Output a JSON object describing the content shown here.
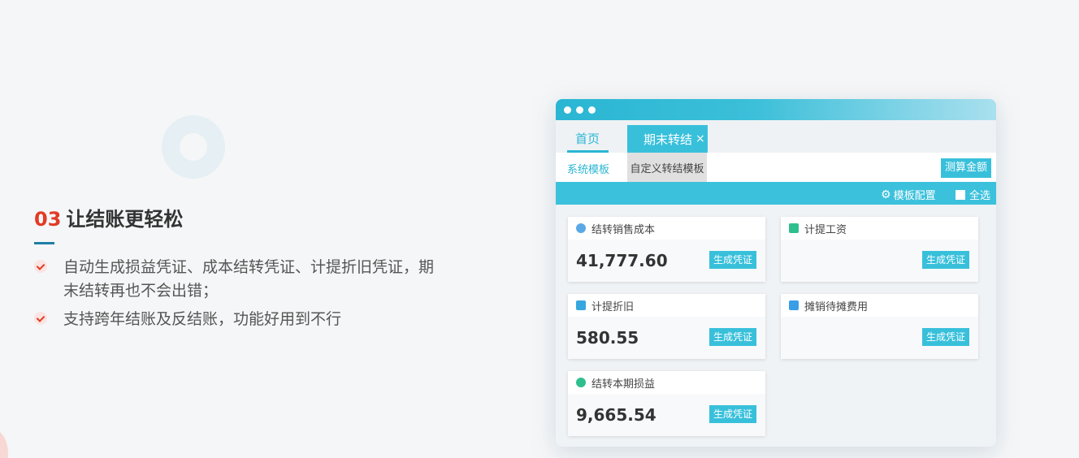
{
  "feature": {
    "number": "03",
    "title": "让结账更轻松",
    "bullets": [
      "自动生成损益凭证、成本结转凭证、计提折旧凭证，期末结转再也不会出错；",
      "支持跨年结账及反结账，功能好用到不行"
    ]
  },
  "app": {
    "tabs": {
      "home": "首页",
      "active": "期末转结",
      "close_icon": "×"
    },
    "subtabs": {
      "system": "系统模板",
      "custom": "自定义转结模板"
    },
    "measure_button": "测算金额",
    "toolbar": {
      "template_config": "模板配置",
      "select_all": "全选"
    },
    "generate_label": "生成凭证",
    "cards": [
      {
        "title": "结转销售成本",
        "amount": "41,777.60",
        "icon": "coin-icon",
        "icon_color": "#5aa9e6"
      },
      {
        "title": "计提工资",
        "amount": "",
        "icon": "document-icon",
        "icon_color": "#2fbf8f"
      },
      {
        "title": "计提折旧",
        "amount": "580.55",
        "icon": "document-icon",
        "icon_color": "#36a7de"
      },
      {
        "title": "摊销待摊费用",
        "amount": "",
        "icon": "grid-icon",
        "icon_color": "#3a9ee6"
      },
      {
        "title": "结转本期损益",
        "amount": "9,665.54",
        "icon": "money-bag-icon",
        "icon_color": "#2fbf8f"
      }
    ]
  },
  "colors": {
    "accent": "#38c0db",
    "highlight": "#e23b26"
  }
}
